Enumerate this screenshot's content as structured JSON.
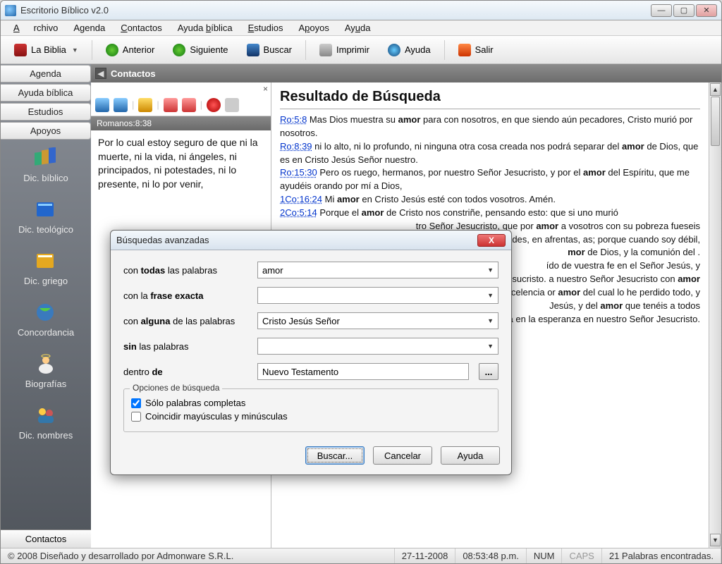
{
  "window": {
    "title": "Escritorio Bíblico v2.0"
  },
  "menu": {
    "archivo": "Archivo",
    "agenda": "Agenda",
    "contactos": "Contactos",
    "ayudabiblica": "Ayuda bíblica",
    "estudios": "Estudios",
    "apoyos": "Apoyos",
    "ayuda": "Ayuda"
  },
  "toolbar": {
    "biblia": "La Biblia",
    "anterior": "Anterior",
    "siguiente": "Siguiente",
    "buscar": "Buscar",
    "imprimir": "Imprimir",
    "ayuda": "Ayuda",
    "salir": "Salir"
  },
  "sidebar": {
    "tabs": {
      "agenda": "Agenda",
      "ayudabiblica": "Ayuda bíblica",
      "estudios": "Estudios",
      "apoyos": "Apoyos"
    },
    "items": [
      {
        "label": "Dic. bíblico"
      },
      {
        "label": "Dic. teológico"
      },
      {
        "label": "Dic. griego"
      },
      {
        "label": "Concordancia"
      },
      {
        "label": "Biografías"
      },
      {
        "label": "Dic. nombres"
      }
    ],
    "footer": "Contactos"
  },
  "paneHeader": "Contactos",
  "mid": {
    "ref": "Romanos:8:38",
    "body": "Por lo cual estoy seguro de que ni la muerte, ni la vida, ni ángeles, ni principados, ni potestades, ni lo presente, ni lo por venir,"
  },
  "results": {
    "title": "Resultado de Búsqueda",
    "lines": [
      {
        "ref": "Ro:5:8",
        "before": "Mas Dios muestra su ",
        "bold": "amor",
        "after": " para con nosotros, en que siendo aún pecadores, Cristo murió por nosotros."
      },
      {
        "ref": "Ro:8:39",
        "before": "ni lo alto, ni lo profundo, ni ninguna otra cosa creada nos podrá separar del ",
        "bold": "amor",
        "after": " de Dios, que es en Cristo Jesús Señor nuestro."
      },
      {
        "ref": "Ro:15:30",
        "before": "Pero os ruego, hermanos, por nuestro Señor Jesucristo, y por el ",
        "bold": "amor",
        "after": " del Espíritu, que me ayudéis orando por mí a Dios,"
      },
      {
        "ref": "1Co:16:24",
        "before": "Mi ",
        "bold": "amor",
        "after": " en Cristo Jesús esté con todos vosotros. Amén."
      },
      {
        "ref": "2Co:5:14",
        "before": "Porque el ",
        "bold": "amor",
        "after": " de Cristo nos constriñe, pensando esto: que si uno murió"
      }
    ],
    "fragments": [
      "tro Señor Jesucristo, que por <b>amor</b> a vosotros con su pobreza fueseis",
      "ozo en las debilidades, en afrentas, as; porque cuando soy débil,",
      "<b>mor</b> de Dios, y la comunión del .",
      "ído de vuestra fe en el Señor Jesús, y",
      ", de Dios Padre y del Señor Jesucristo. a nuestro Señor Jesucristo con <b>amor</b>",
      "sas como pérdida por la excelencia or <b>amor</b> del cual lo he perdido todo, y",
      "Jesús, y del <b>amor</b> que tenéis a todos",
      "Dios y Padre nuestro de la obra de uestra constancia en la esperanza en nuestro Señor Jesucristo."
    ]
  },
  "dialog": {
    "title": "Búsquedas avanzadas",
    "labels": {
      "todas_pre": "con ",
      "todas_b": "todas",
      "todas_post": " las palabras",
      "frase_pre": "con la ",
      "frase_b": "frase exacta",
      "frase_post": "",
      "alguna_pre": "con ",
      "alguna_b": "alguna",
      "alguna_post": " de las palabras",
      "sin_pre": "",
      "sin_b": "sin",
      "sin_post": " las palabras",
      "dentro_pre": "dentro ",
      "dentro_b": "de",
      "dentro_post": ""
    },
    "values": {
      "todas": "amor",
      "frase": "",
      "alguna": "Cristo Jesús Señor",
      "sin": "",
      "dentro": "Nuevo Testamento"
    },
    "options_legend": "Opciones de búsqueda",
    "opt1": "Sólo palabras completas",
    "opt2": "Coincidir mayúsculas y minúsculas",
    "buttons": {
      "buscar": "Buscar...",
      "cancelar": "Cancelar",
      "ayuda": "Ayuda"
    },
    "browse": "..."
  },
  "status": {
    "copyright": "© 2008 Diseñado y desarrollado por Admonware S.R.L.",
    "date": "27-11-2008",
    "time": "08:53:48 p.m.",
    "num": "NUM",
    "caps": "CAPS",
    "found": "21 Palabras encontradas."
  }
}
